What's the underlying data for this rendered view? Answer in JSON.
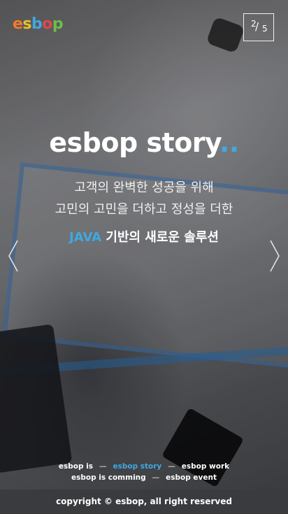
{
  "brand": {
    "logo_letters": [
      {
        "ch": "e",
        "color": "#f07b2a"
      },
      {
        "ch": "s",
        "color": "#e8c02a"
      },
      {
        "ch": "b",
        "color": "#3fa9e0"
      },
      {
        "ch": "o",
        "color": "#e2474b"
      },
      {
        "ch": "p",
        "color": "#6cbf4a"
      }
    ],
    "accent_color": "#3fa9e0"
  },
  "slide_counter": {
    "current": "2",
    "separator": "/",
    "total": "5"
  },
  "hero": {
    "title": "esbop story",
    "title_dots": "..",
    "subtitle_line1": "고객의 완벽한 성공을 위해",
    "subtitle_line2": "고민의 고민을 더하고 정성을 더한",
    "highlight_java": "JAVA",
    "highlight_rest": " 기반의 새로운 솔루션"
  },
  "controls": {
    "prev_icon": "chevron-left-icon",
    "next_icon": "chevron-right-icon"
  },
  "nav": {
    "separator": "—",
    "row1": [
      {
        "label": "esbop is",
        "active": false
      },
      {
        "label": "esbop story",
        "active": true
      },
      {
        "label": "esbop work",
        "active": false
      }
    ],
    "row2": [
      {
        "label": "esbop is comming",
        "active": false
      },
      {
        "label": "esbop event",
        "active": false
      }
    ]
  },
  "footer": {
    "copyright": "copyright © esbop, all right reserved"
  }
}
